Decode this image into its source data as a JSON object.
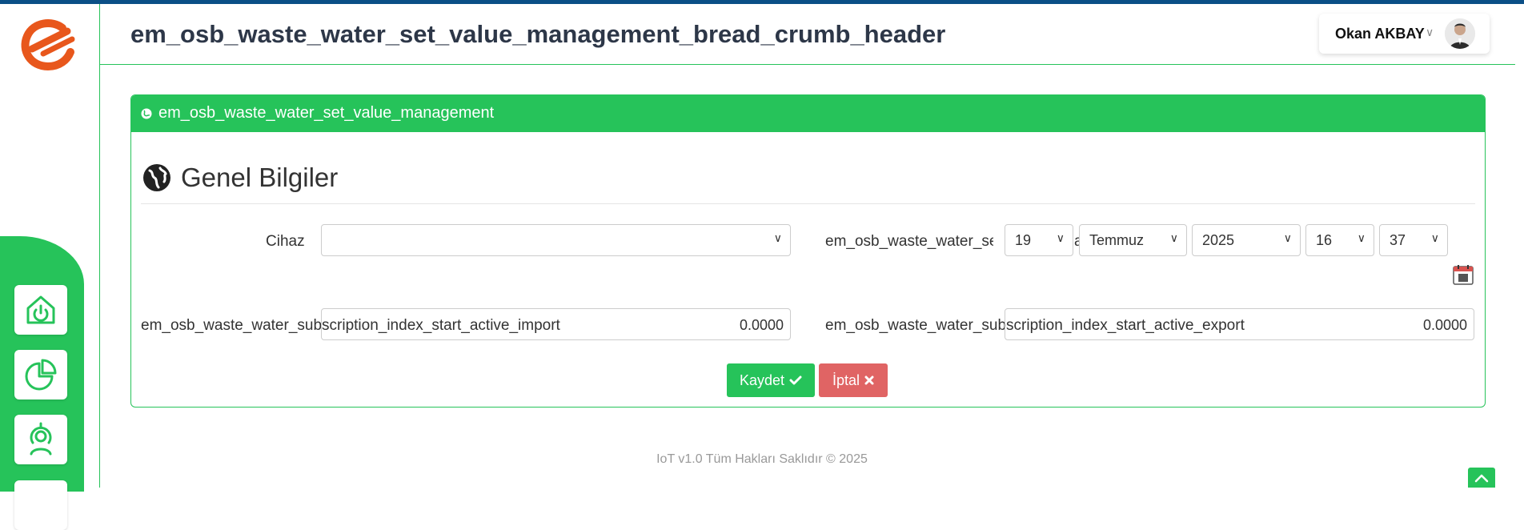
{
  "header": {
    "title": "em_osb_waste_water_set_value_management_bread_crumb_header"
  },
  "user": {
    "name": "Okan AKBAY"
  },
  "sidebar": {
    "items": [
      {
        "icon": "power-home-icon"
      },
      {
        "icon": "pie-chart-icon"
      },
      {
        "icon": "user-broadcast-icon"
      }
    ]
  },
  "panel": {
    "title": "em_osb_waste_water_set_value_management",
    "section_title": "Genel Bilgiler"
  },
  "form": {
    "device_label": "Cihaz",
    "device_value": "",
    "date_label": "em_osb_waste_water_set_va",
    "date_sep": "a",
    "day": "19",
    "month": "Temmuz",
    "year": "2025",
    "hour": "16",
    "minute": "37",
    "import_label": "em_osb_waste_water_subscription_index_start_active_import",
    "import_value": "0.0000",
    "export_label": "em_osb_waste_water_subscription_index_start_active_export",
    "export_value": "0.0000"
  },
  "buttons": {
    "save": "Kaydet",
    "cancel": "İptal"
  },
  "footer": {
    "text": "IoT v1.0 Tüm Hakları Saklıdır © 2025"
  },
  "colors": {
    "primary_green": "#26c35a",
    "danger": "#e06464",
    "brand_orange": "#e8571c",
    "top_strip": "#0b4f86"
  }
}
